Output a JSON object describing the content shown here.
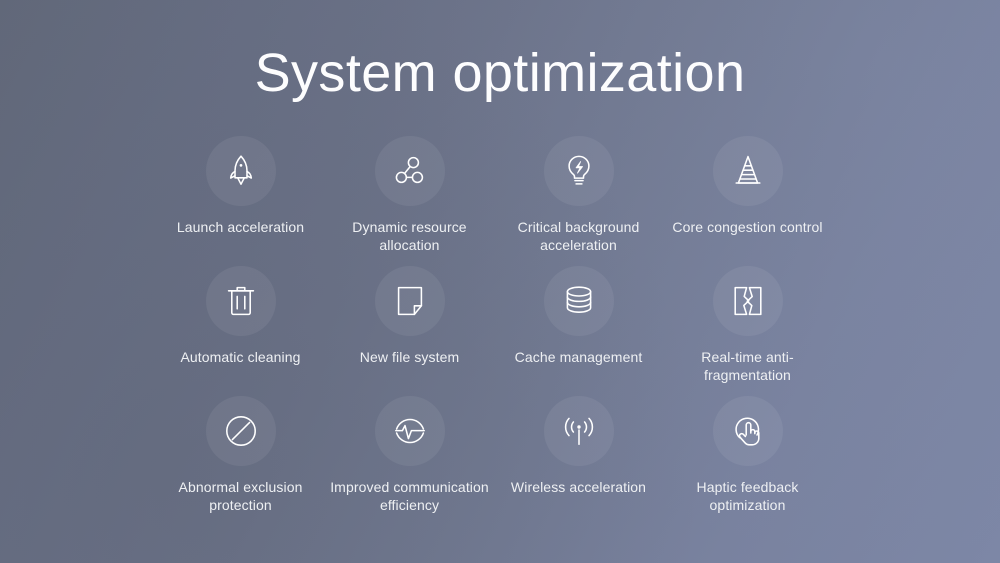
{
  "slide": {
    "title": "System optimization",
    "background": {
      "from": "#616879",
      "mid": "#6b7288",
      "to": "#7d87a6"
    },
    "text_color": "#eef0f3",
    "title_color": "#fdfdfe",
    "disc_color": "rgba(255,255,255,0.065)"
  },
  "features": [
    {
      "label": "Launch acceleration",
      "icon": "rocket-icon"
    },
    {
      "label": "Dynamic resource allocation",
      "icon": "node-graph-icon"
    },
    {
      "label": "Critical background acceleration",
      "icon": "lightbulb-bolt-icon"
    },
    {
      "label": "Core congestion control",
      "icon": "traffic-cone-icon"
    },
    {
      "label": "Automatic cleaning",
      "icon": "trash-can-icon"
    },
    {
      "label": "New file system",
      "icon": "document-page-icon"
    },
    {
      "label": "Cache management",
      "icon": "database-stack-icon"
    },
    {
      "label": "Real-time anti-fragmentation",
      "icon": "cracked-square-icon"
    },
    {
      "label": "Abnormal exclusion protection",
      "icon": "prohibited-circle-icon"
    },
    {
      "label": "Improved communication efficiency",
      "icon": "pulse-circle-icon"
    },
    {
      "label": "Wireless acceleration",
      "icon": "wireless-signal-icon"
    },
    {
      "label": "Haptic feedback optimization",
      "icon": "hand-tap-icon"
    }
  ]
}
